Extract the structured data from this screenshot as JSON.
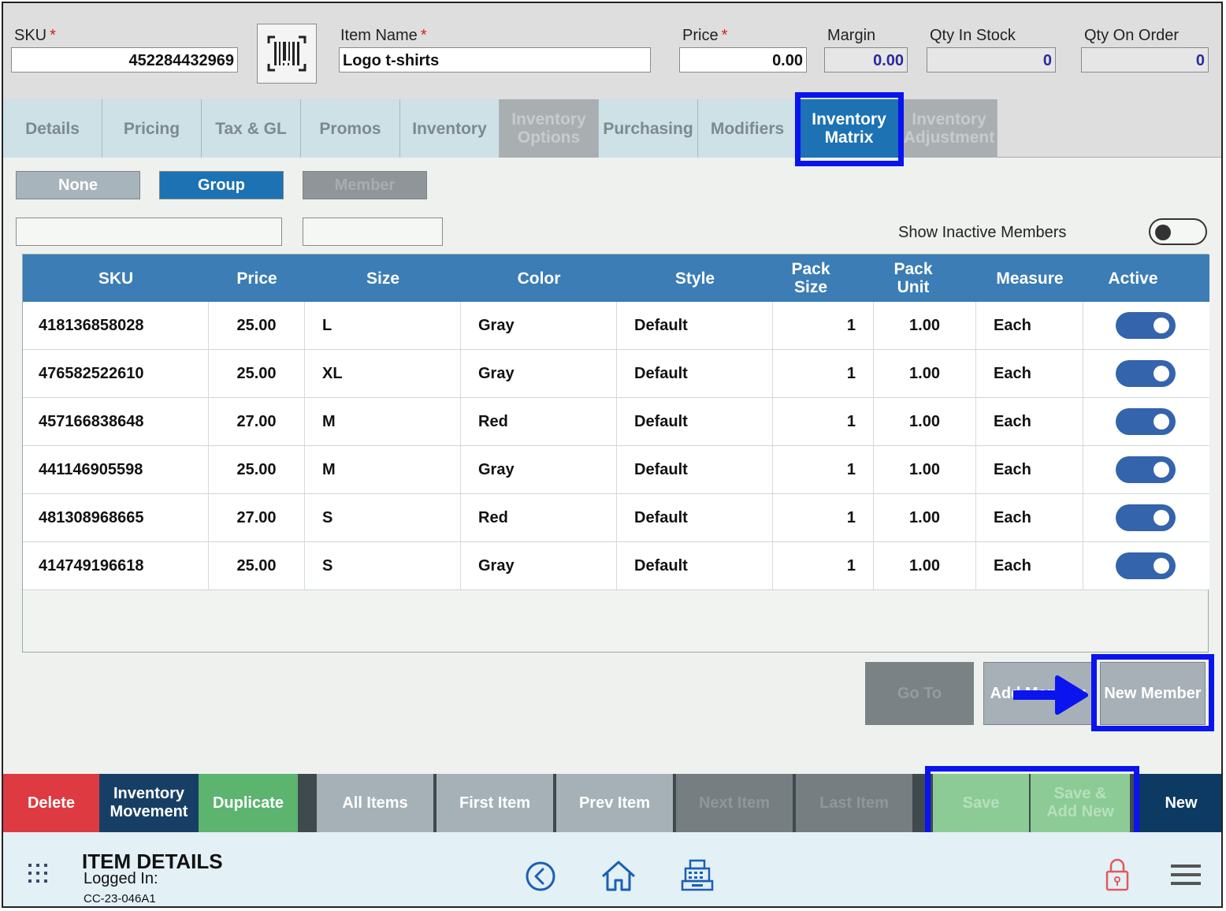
{
  "header": {
    "sku_label": "SKU",
    "sku_value": "452284432969",
    "item_name_label": "Item Name",
    "item_name_value": "Logo t-shirts",
    "price_label": "Price",
    "price_value": "0.00",
    "margin_label": "Margin",
    "margin_value": "0.00",
    "qty_in_stock_label": "Qty In Stock",
    "qty_in_stock_value": "0",
    "qty_on_order_label": "Qty On Order",
    "qty_on_order_value": "0",
    "required_mark": "*"
  },
  "tabs": [
    {
      "label": "Details",
      "state": "normal"
    },
    {
      "label": "Pricing",
      "state": "normal"
    },
    {
      "label": "Tax & GL",
      "state": "normal"
    },
    {
      "label": "Promos",
      "state": "normal"
    },
    {
      "label": "Inventory",
      "state": "normal"
    },
    {
      "label": "Inventory Options",
      "state": "disabled"
    },
    {
      "label": "Purchasing",
      "state": "normal"
    },
    {
      "label": "Modifiers",
      "state": "normal"
    },
    {
      "label": "Inventory Matrix",
      "state": "active"
    },
    {
      "label": "Inventory Adjustment",
      "state": "disabled"
    }
  ],
  "matrix_mode": {
    "none_label": "None",
    "group_label": "Group",
    "member_label": "Member",
    "selected": "Group"
  },
  "show_inactive": {
    "label": "Show Inactive Members",
    "on": false
  },
  "grid": {
    "columns": [
      "SKU",
      "Price",
      "Size",
      "Color",
      "Style",
      "Pack Size",
      "Pack Unit",
      "Measure",
      "Active"
    ],
    "rows": [
      {
        "sku": "418136858028",
        "price": "25.00",
        "size": "L",
        "color": "Gray",
        "style": "Default",
        "pack_size": "1",
        "pack_unit": "1.00",
        "measure": "Each",
        "active": true
      },
      {
        "sku": "476582522610",
        "price": "25.00",
        "size": "XL",
        "color": "Gray",
        "style": "Default",
        "pack_size": "1",
        "pack_unit": "1.00",
        "measure": "Each",
        "active": true
      },
      {
        "sku": "457166838648",
        "price": "27.00",
        "size": "M",
        "color": "Red",
        "style": "Default",
        "pack_size": "1",
        "pack_unit": "1.00",
        "measure": "Each",
        "active": true
      },
      {
        "sku": "441146905598",
        "price": "25.00",
        "size": "M",
        "color": "Gray",
        "style": "Default",
        "pack_size": "1",
        "pack_unit": "1.00",
        "measure": "Each",
        "active": true
      },
      {
        "sku": "481308968665",
        "price": "27.00",
        "size": "S",
        "color": "Red",
        "style": "Default",
        "pack_size": "1",
        "pack_unit": "1.00",
        "measure": "Each",
        "active": true
      },
      {
        "sku": "414749196618",
        "price": "25.00",
        "size": "S",
        "color": "Gray",
        "style": "Default",
        "pack_size": "1",
        "pack_unit": "1.00",
        "measure": "Each",
        "active": true
      }
    ]
  },
  "actions": {
    "goto_label": "Go To",
    "add_member_label": "Add Member",
    "new_member_label": "New Member"
  },
  "bottom_bar": {
    "delete": "Delete",
    "inventory_movement": "Inventory Movement",
    "duplicate": "Duplicate",
    "all_items": "All Items",
    "first_item": "First Item",
    "prev_item": "Prev Item",
    "next_item": "Next Item",
    "last_item": "Last Item",
    "save": "Save",
    "save_add_new": "Save & Add New",
    "new": "New"
  },
  "footer": {
    "title": "ITEM DETAILS",
    "logged_in_label": "Logged In:",
    "user": "CC-23-046A1",
    "icons": [
      "apps-grid-icon",
      "back-icon",
      "home-icon",
      "register-icon",
      "lock-icon",
      "menu-icon"
    ]
  },
  "colors": {
    "accent_blue": "#1c72b2",
    "grid_header": "#3b7db4",
    "toggle_on": "#3464ab",
    "delete_red": "#de3a41",
    "inventory_movement_navy": "#173f66",
    "duplicate_green": "#5cb46f",
    "save_green": "#8ccb96",
    "new_navy": "#0c3a62",
    "highlight_blue": "#0a14ee"
  }
}
